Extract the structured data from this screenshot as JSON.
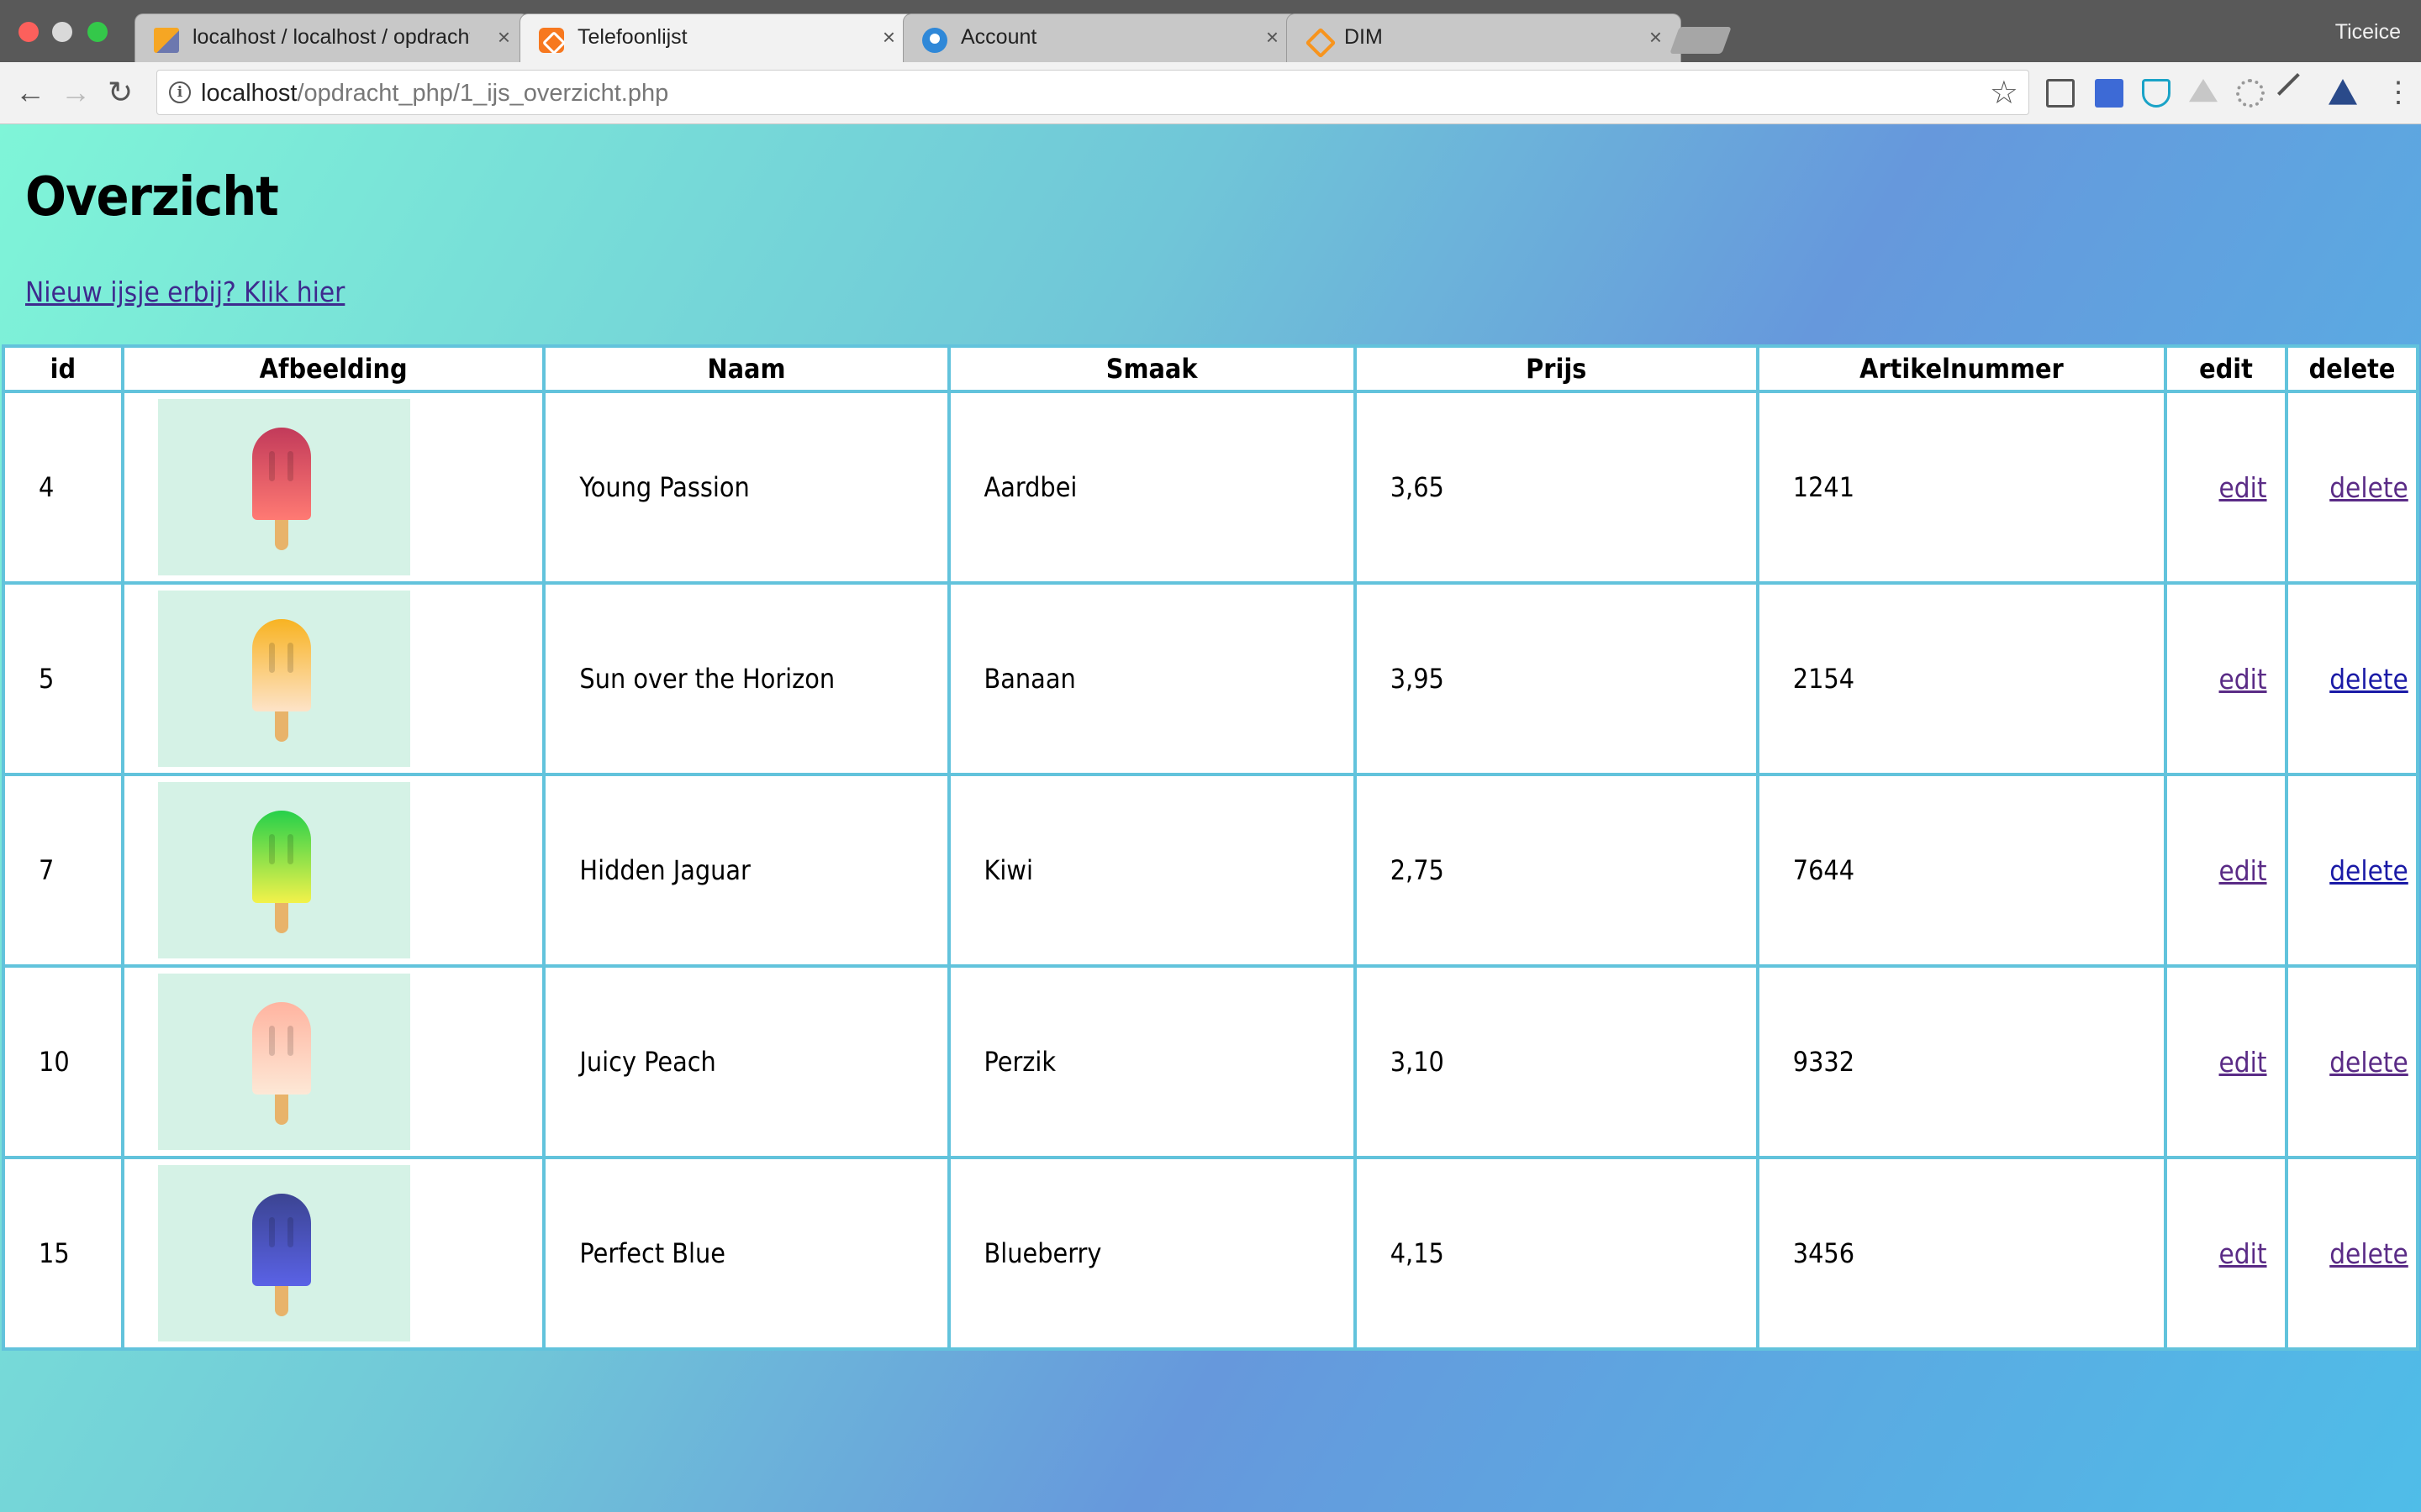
{
  "browser": {
    "tabs": [
      {
        "title": "localhost / localhost / opdracht_php",
        "favicon": "phpmyadmin-icon",
        "active": false
      },
      {
        "title": "Telefoonlijst",
        "favicon": "xampp-icon",
        "active": true
      },
      {
        "title": "Account",
        "favicon": "account-icon",
        "active": false
      },
      {
        "title": "DIM",
        "favicon": "dim-icon",
        "active": false
      }
    ],
    "tab_close": "×",
    "profile_name": "Ticeice",
    "url_host": "localhost",
    "url_path": "/opdracht_php/1_ijs_overzicht.php",
    "nav": {
      "back": "←",
      "forward": "→",
      "reload": "↻",
      "star": "☆",
      "menu": "⋮",
      "info": "i"
    }
  },
  "page": {
    "title": "Overzicht",
    "add_link": "Nieuw ijsje erbij? Klik hier",
    "columns": [
      "id",
      "Afbeelding",
      "Naam",
      "Smaak",
      "Prijs",
      "Artikelnummer",
      "edit",
      "delete"
    ],
    "rows": [
      {
        "id": "4",
        "naam": "Young Passion",
        "smaak": "Aardbei",
        "prijs": "3,65",
        "artikelnummer": "1241",
        "edit": "edit",
        "delete": "delete",
        "popsicle_top": "#c23a5a",
        "popsicle_bottom": "#ff7a73"
      },
      {
        "id": "5",
        "naam": "Sun over the Horizon",
        "smaak": "Banaan",
        "prijs": "3,95",
        "artikelnummer": "2154",
        "edit": "edit",
        "delete": "delete",
        "popsicle_top": "#f8b322",
        "popsicle_bottom": "#fde3c8"
      },
      {
        "id": "7",
        "naam": "Hidden Jaguar",
        "smaak": "Kiwi",
        "prijs": "2,75",
        "artikelnummer": "7644",
        "edit": "edit",
        "delete": "delete",
        "popsicle_top": "#26d04a",
        "popsicle_bottom": "#f3f24a"
      },
      {
        "id": "10",
        "naam": "Juicy Peach",
        "smaak": "Perzik",
        "prijs": "3,10",
        "artikelnummer": "9332",
        "edit": "edit",
        "delete": "delete",
        "popsicle_top": "#ffb4a0",
        "popsicle_bottom": "#fde8d6"
      },
      {
        "id": "15",
        "naam": "Perfect Blue",
        "smaak": "Blueberry",
        "prijs": "4,15",
        "artikelnummer": "3456",
        "edit": "edit",
        "delete": "delete",
        "popsicle_top": "#3b4492",
        "popsicle_bottom": "#5a62e6"
      }
    ]
  },
  "colors": {
    "page_gradient": [
      "#7ff5d8",
      "#70c6d8",
      "#6698dc",
      "#4fbde8"
    ],
    "table_border": "#62c3dc",
    "thumb_bg": "#d5f2e6",
    "link_visited": "#5a2b86",
    "link": "#1a1aa6"
  }
}
